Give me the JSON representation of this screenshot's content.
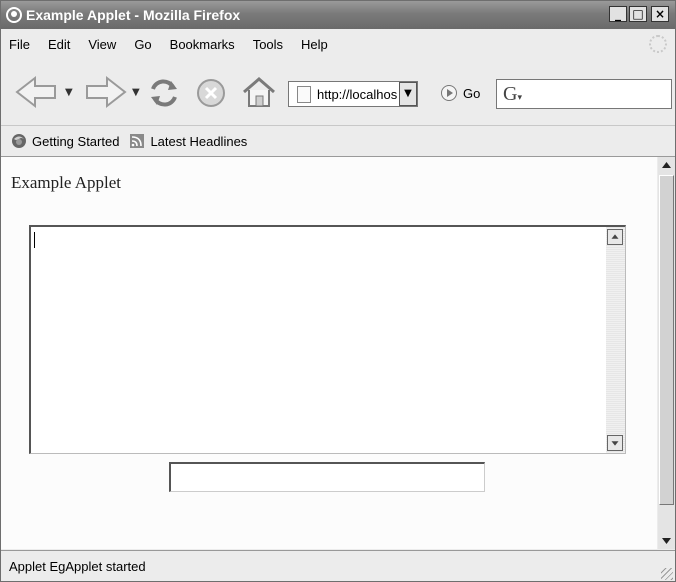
{
  "window": {
    "title": "Example Applet - Mozilla Firefox"
  },
  "menu": {
    "items": [
      {
        "label": "File"
      },
      {
        "label": "Edit"
      },
      {
        "label": "View"
      },
      {
        "label": "Go"
      },
      {
        "label": "Bookmarks"
      },
      {
        "label": "Tools"
      },
      {
        "label": "Help"
      }
    ]
  },
  "navbar": {
    "url_value": "http://localhost",
    "go_label": "Go",
    "search_value": ""
  },
  "bookmarks": {
    "items": [
      {
        "label": "Getting Started",
        "icon": "firefox-icon"
      },
      {
        "label": "Latest Headlines",
        "icon": "rss-feed-icon"
      }
    ]
  },
  "content": {
    "heading": "Example Applet",
    "textarea_value": "",
    "textfield_value": ""
  },
  "status": {
    "text": "Applet EgApplet started"
  },
  "colors": {
    "titlebar": "#7a7a7a",
    "chrome": "#ececec",
    "content": "#fcfcfc"
  }
}
